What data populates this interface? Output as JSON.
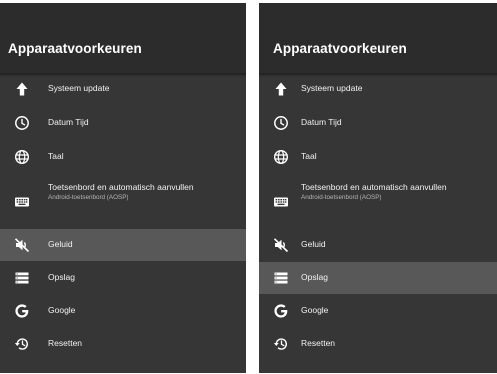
{
  "screens": [
    {
      "title": "Apparaatvoorkeuren",
      "selected_index": 4,
      "items": [
        {
          "label": "Systeem update",
          "icon": "arrow-up-icon"
        },
        {
          "label": "Datum Tijd",
          "icon": "clock-icon"
        },
        {
          "label": "Taal",
          "icon": "globe-icon"
        },
        {
          "label": "Toetsenbord en automatisch aanvullen",
          "sublabel": "Android-toetsenbord (AOSP)",
          "icon": "keyboard-icon"
        },
        {
          "label": "Geluid",
          "icon": "volume-off-icon"
        },
        {
          "label": "Opslag",
          "icon": "storage-icon"
        },
        {
          "label": "Google",
          "icon": "google-icon"
        },
        {
          "label": "Resetten",
          "icon": "restore-icon"
        }
      ]
    },
    {
      "title": "Apparaatvoorkeuren",
      "selected_index": 5,
      "items": [
        {
          "label": "Systeem update",
          "icon": "arrow-up-icon"
        },
        {
          "label": "Datum Tijd",
          "icon": "clock-icon"
        },
        {
          "label": "Taal",
          "icon": "globe-icon"
        },
        {
          "label": "Toetsenbord en automatisch aanvullen",
          "sublabel": "Android-toetsenbord (AOSP)",
          "icon": "keyboard-icon"
        },
        {
          "label": "Geluid",
          "icon": "volume-off-icon"
        },
        {
          "label": "Opslag",
          "icon": "storage-icon"
        },
        {
          "label": "Google",
          "icon": "google-icon"
        },
        {
          "label": "Resetten",
          "icon": "restore-icon"
        }
      ]
    }
  ],
  "colors": {
    "panel_background": "#2c2c2c",
    "list_background": "#363636",
    "selected_background": "#585858",
    "text": "#f2f2f2",
    "subtext": "#b5b5b5"
  }
}
